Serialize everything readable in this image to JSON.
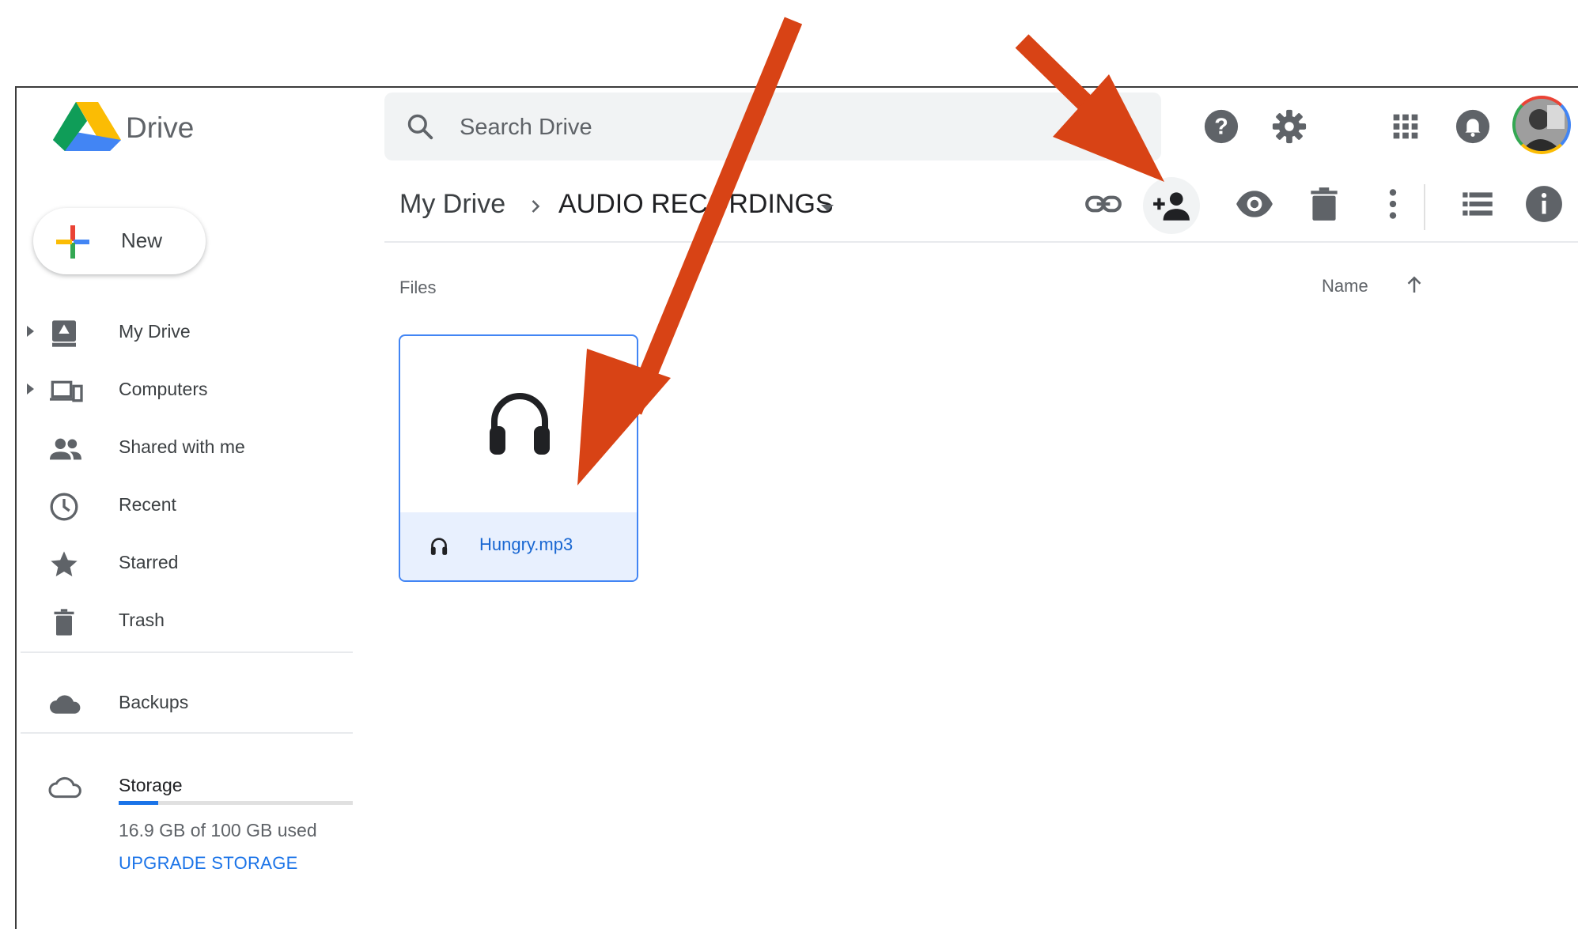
{
  "app": {
    "name": "Drive"
  },
  "search": {
    "placeholder": "Search Drive"
  },
  "header_icons": [
    "help-icon",
    "settings-icon",
    "apps-icon",
    "notifications-icon",
    "account-avatar"
  ],
  "breadcrumb": {
    "root": "My Drive",
    "current": "AUDIO RECORDINGS"
  },
  "toolbar": [
    "get-link-icon",
    "share-icon",
    "preview-icon",
    "delete-icon",
    "more-icon",
    "list-view-icon",
    "details-icon"
  ],
  "files_section": {
    "label": "Files",
    "sort_label": "Name",
    "sort_direction": "ascending"
  },
  "files": [
    {
      "name": "Hungry.mp3",
      "icon": "headphones-icon"
    }
  ],
  "sidebar": {
    "new_label": "New",
    "items": [
      {
        "label": "My Drive",
        "icon": "my-drive-icon",
        "expandable": true
      },
      {
        "label": "Computers",
        "icon": "computers-icon",
        "expandable": true
      },
      {
        "label": "Shared with me",
        "icon": "shared-icon",
        "expandable": false
      },
      {
        "label": "Recent",
        "icon": "clock-icon",
        "expandable": false
      },
      {
        "label": "Starred",
        "icon": "star-icon",
        "expandable": false
      },
      {
        "label": "Trash",
        "icon": "trash-icon",
        "expandable": false
      },
      {
        "label": "Backups",
        "icon": "cloud-icon",
        "expandable": false
      }
    ],
    "storage": {
      "label": "Storage",
      "used_text": "16.9 GB of 100 GB used",
      "used_fraction": 0.169,
      "upgrade_label": "UPGRADE STORAGE"
    }
  },
  "colors": {
    "accent": "#1a73e8",
    "annotation_arrow": "#d84315",
    "selected_bg": "#e8f0fe"
  }
}
